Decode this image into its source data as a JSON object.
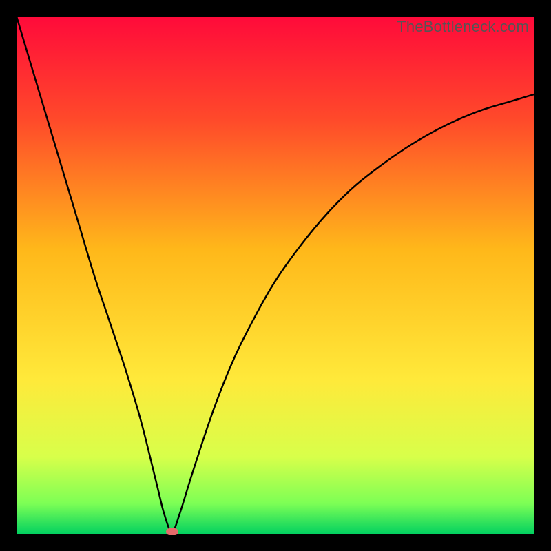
{
  "watermark": "TheBottleneck.com",
  "colors": {
    "top": "#ff0a3a",
    "upper_mid": "#ff6a1a",
    "mid": "#ffd21a",
    "lower_mid": "#f7ff4a",
    "near_bottom": "#9dff5a",
    "bottom": "#00d060",
    "curve": "#000000",
    "marker": "#e46a6a",
    "frame": "#000000"
  },
  "chart_data": {
    "type": "line",
    "title": "",
    "xlabel": "",
    "ylabel": "",
    "xlim": [
      0,
      100
    ],
    "ylim": [
      0,
      100
    ],
    "grid": false,
    "legend": false,
    "notes": "V-shaped bottleneck curve on vertical red→green gradient. Minimum (≈0) near x≈30; left branch rises steeply to ≈100 at x=0; right branch rises with decreasing slope to ≈85 at x=100. Small pink marker at the minimum.",
    "series": [
      {
        "name": "bottleneck-curve",
        "x": [
          0,
          3,
          6,
          9,
          12,
          15,
          18,
          21,
          24,
          27,
          28.5,
          30,
          31.5,
          34,
          38,
          42,
          46,
          50,
          55,
          60,
          65,
          70,
          75,
          80,
          85,
          90,
          95,
          100
        ],
        "y": [
          100,
          90,
          80,
          70,
          60,
          50,
          41,
          32,
          22,
          10,
          4,
          0.5,
          4,
          12,
          24,
          34,
          42,
          49,
          56,
          62,
          67,
          71,
          74.5,
          77.5,
          80,
          82,
          83.5,
          85
        ]
      }
    ],
    "marker": {
      "x": 30,
      "y": 0.5
    },
    "gradient_stops": [
      {
        "pos": 0.0,
        "color": "#ff0a3a"
      },
      {
        "pos": 0.2,
        "color": "#ff4a2a"
      },
      {
        "pos": 0.45,
        "color": "#ffb81a"
      },
      {
        "pos": 0.7,
        "color": "#ffe93a"
      },
      {
        "pos": 0.85,
        "color": "#d8ff4a"
      },
      {
        "pos": 0.94,
        "color": "#7dff55"
      },
      {
        "pos": 1.0,
        "color": "#00d060"
      }
    ]
  }
}
